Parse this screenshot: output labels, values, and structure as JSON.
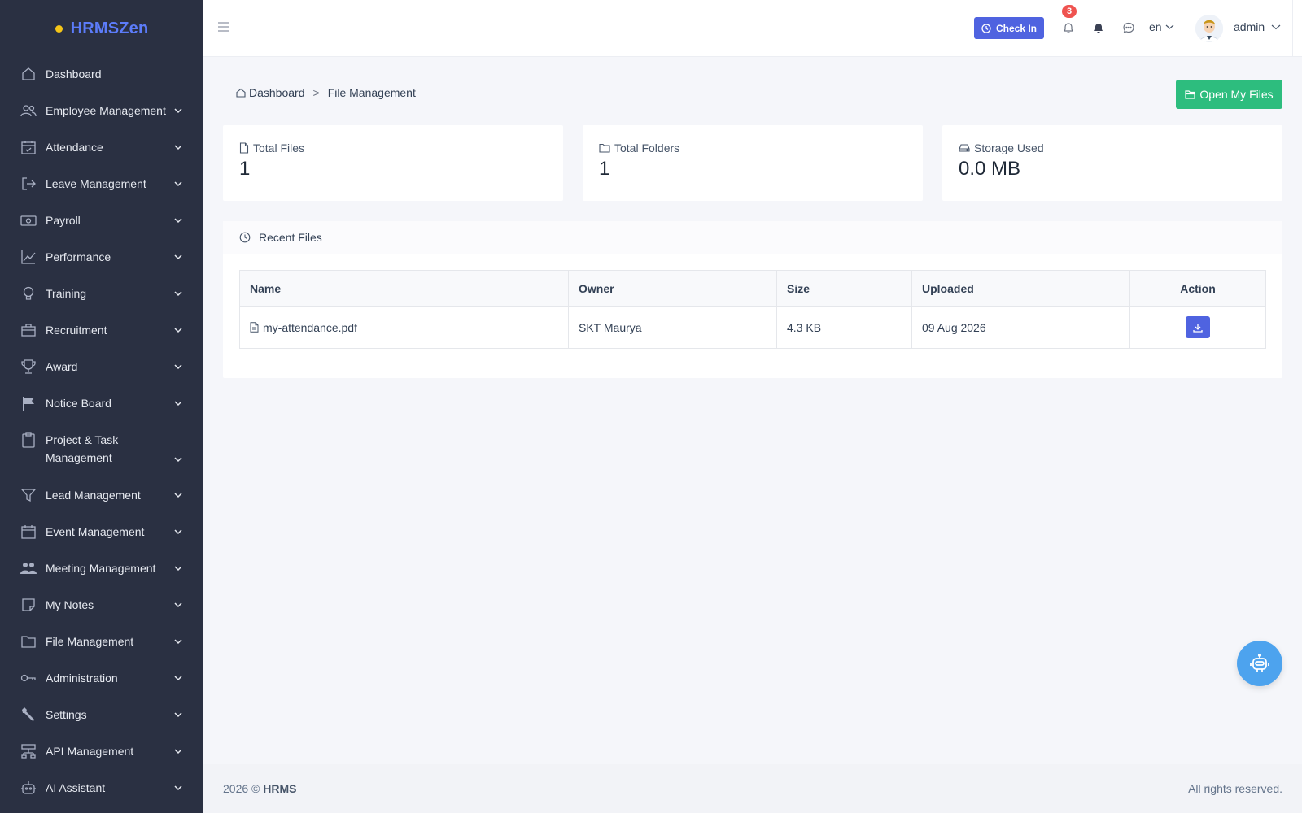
{
  "brand": {
    "name": "HRMSZen"
  },
  "sidebar": {
    "items": [
      {
        "label": "Dashboard",
        "icon": "home-icon",
        "has_children": false
      },
      {
        "label": "Employee Management",
        "icon": "users-icon",
        "has_children": true
      },
      {
        "label": "Attendance",
        "icon": "calendar-check-icon",
        "has_children": true
      },
      {
        "label": "Leave Management",
        "icon": "sign-out-icon",
        "has_children": true
      },
      {
        "label": "Payroll",
        "icon": "money-icon",
        "has_children": true
      },
      {
        "label": "Performance",
        "icon": "chart-line-icon",
        "has_children": true
      },
      {
        "label": "Training",
        "icon": "lightbulb-icon",
        "has_children": true
      },
      {
        "label": "Recruitment",
        "icon": "briefcase-icon",
        "has_children": true
      },
      {
        "label": "Award",
        "icon": "trophy-icon",
        "has_children": true
      },
      {
        "label": "Notice Board",
        "icon": "flag-icon",
        "has_children": true
      },
      {
        "label": "Project & Task Management",
        "icon": "clipboard-icon",
        "has_children": true
      },
      {
        "label": "Lead Management",
        "icon": "funnel-icon",
        "has_children": true
      },
      {
        "label": "Event Management",
        "icon": "calendar-icon",
        "has_children": true
      },
      {
        "label": "Meeting Management",
        "icon": "group-icon",
        "has_children": true
      },
      {
        "label": "My Notes",
        "icon": "note-icon",
        "has_children": true
      },
      {
        "label": "File Management",
        "icon": "folder-icon",
        "has_children": true
      },
      {
        "label": "Administration",
        "icon": "key-icon",
        "has_children": true
      },
      {
        "label": "Settings",
        "icon": "wrench-icon",
        "has_children": true
      },
      {
        "label": "API Management",
        "icon": "network-icon",
        "has_children": true
      },
      {
        "label": "AI Assistant",
        "icon": "robot-icon",
        "has_children": true
      }
    ]
  },
  "topbar": {
    "check_in_label": "Check In",
    "notification_count": "3",
    "language": "en",
    "username": "admin"
  },
  "breadcrumb": {
    "home": "Dashboard",
    "separator": ">",
    "current": "File Management"
  },
  "actions": {
    "open_my_files": "Open My Files"
  },
  "stats": {
    "total_files": {
      "label": "Total Files",
      "value": "1"
    },
    "total_folders": {
      "label": "Total Folders",
      "value": "1"
    },
    "storage_used": {
      "label": "Storage Used",
      "value": "0.0 MB"
    }
  },
  "recent_files": {
    "title": "Recent Files",
    "columns": {
      "name": "Name",
      "owner": "Owner",
      "size": "Size",
      "uploaded": "Uploaded",
      "action": "Action"
    },
    "rows": [
      {
        "name": "my-attendance.pdf",
        "owner": "SKT Maurya",
        "size": "4.3 KB",
        "uploaded": "09 Aug 2026"
      }
    ]
  },
  "footer": {
    "year": "2026 ©",
    "brand": "HRMS",
    "rights": "All rights reserved."
  },
  "colors": {
    "sidebar_bg": "#2a3042",
    "primary": "#4f63e0",
    "success": "#2dbd7e",
    "danger": "#ef5350",
    "bot": "#4da3ee"
  }
}
